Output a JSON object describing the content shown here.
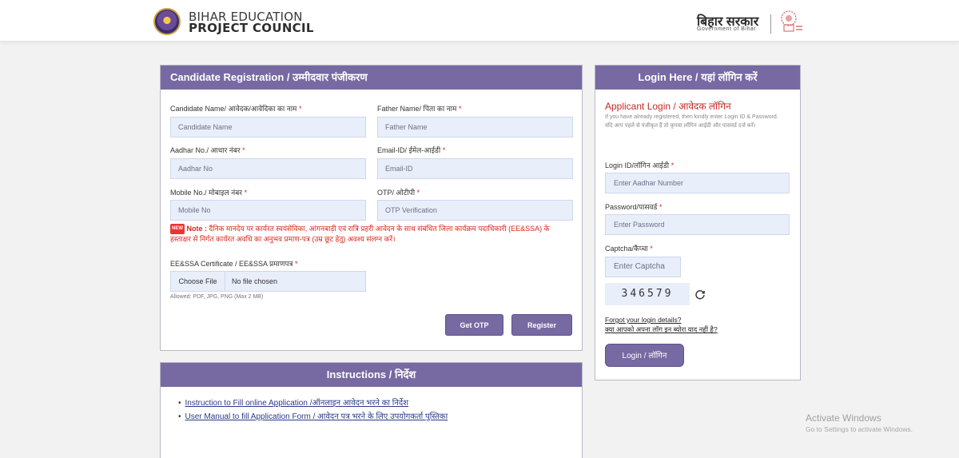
{
  "header": {
    "brand_line1": "BIHAR EDUCATION",
    "brand_line2": "PROJECT COUNCIL",
    "govt_hindi": "बिहार सरकार",
    "govt_english": "Government of Bihar"
  },
  "registration": {
    "title": "Candidate Registration / उम्मीदवार पंजीकरण",
    "fields": {
      "candidate_name": {
        "label": "Candidate Name/ आवेदक/आवेदिका का नाम",
        "placeholder": "Candidate Name",
        "required": "*"
      },
      "father_name": {
        "label": "Father Name/ पिता का नाम",
        "placeholder": "Father Name",
        "required": "*"
      },
      "aadhar": {
        "label": "Aadhar No./ आधार नंबर",
        "placeholder": "Aadhar No",
        "required": "*"
      },
      "email": {
        "label": "Email-ID/ ईमेल-आईडी",
        "placeholder": "Email-ID",
        "required": "*"
      },
      "mobile": {
        "label": "Mobile No./ मोबाइल नंबर",
        "placeholder": "Mobile No",
        "required": "*"
      },
      "otp": {
        "label": "OTP/ ओटीपी",
        "placeholder": "OTP Verification",
        "required": "*"
      }
    },
    "note_badge": "NEW",
    "note_prefix": "Note :",
    "note_text": "दैनिक मानदेय पर कार्यरत स्वयंसेविका, आंगनबाड़ी एवं रात्रि प्रहरी आवेदन के साथ संबंधित जिला कार्यक्रम पदाधिकारी (EE&SSA) के हस्ताक्षर से निर्गत कार्यरत अवधि का अनुभव प्रमाण-पत्र (उम्र छूट हेतु) अवश्य संलग्न करें।",
    "certificate": {
      "label": "EE&SSA Certificate / EE&SSA प्रमाणपत्र",
      "required": "*",
      "choose_label": "Choose File",
      "status": "No file chosen",
      "allowed": "Allowed: PDF, JPG, PNG (Max 2 MB)"
    },
    "get_otp_label": "Get OTP",
    "register_label": "Register"
  },
  "instructions": {
    "title": "Instructions / निर्देश",
    "items": [
      "Instruction to Fill online Application /ऑनलाइन आवेदन भरने का निर्देश",
      "User Manual to fill Application Form / आवेदन पत्र भरने के लिए उपयोगकर्ता पुस्तिका"
    ]
  },
  "login": {
    "title": "Login Here / यहां लॉगिन करें",
    "subtitle": "Applicant Login / आवेदक लॉगिन",
    "info_en": "If you have already registered, then kindly enter Login ID & Password.",
    "info_hi": "यदि आप पहले से पंजीकृत हैं तो कृपया लॉगिन आईडी और पासवर्ड दर्ज करें।",
    "login_id_label": "Login ID/लॉगिन आईडी",
    "login_id_placeholder": "Enter Aadhar Number",
    "password_label": "Password/पासवर्ड",
    "password_placeholder": "Enter Password",
    "captcha_label": "Captcha/कैप्चा",
    "captcha_placeholder": "Enter Captcha",
    "captcha_value": "346579",
    "required": "*",
    "forgot_en": "Forgot your login details?",
    "forgot_hi": "क्या आपको अपना लॉग इन ब्योरा याद नहीं है?",
    "button_label": "Login / लॉगिन"
  },
  "watermark": {
    "line1": "Activate Windows",
    "line2": "Go to Settings to activate Windows."
  },
  "colors": {
    "panel_header": "#7769a2",
    "input_bg": "#e9eefb",
    "required": "#d9261c",
    "link": "#2b3a8a"
  }
}
